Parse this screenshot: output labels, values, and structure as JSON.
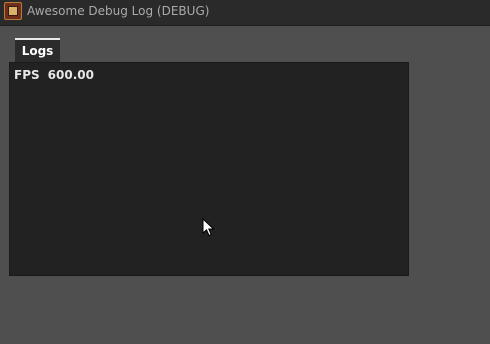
{
  "window": {
    "title": "Awesome Debug Log (DEBUG)"
  },
  "tabs": [
    {
      "label": "Logs",
      "active": true
    }
  ],
  "log": {
    "fps_label": "FPS",
    "fps_value": "600.00"
  },
  "icons": {
    "app": "app-icon",
    "cursor": "mouse-cursor-icon"
  },
  "colors": {
    "background": "#4f4f4f",
    "titlebar": "#2a2a2a",
    "panel": "#222222",
    "tab_active_border": "#e8e8e8",
    "text": "#e6e6e6"
  }
}
